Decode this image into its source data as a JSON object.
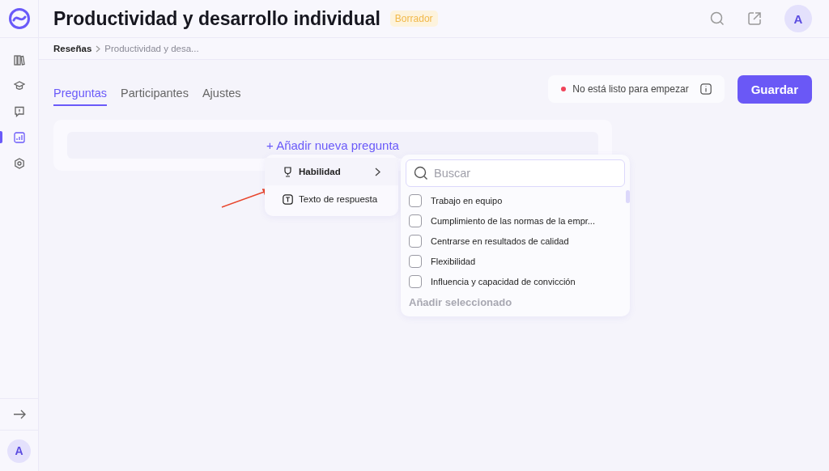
{
  "sidebar": {
    "items": [
      {
        "kind": "library",
        "selected": false
      },
      {
        "kind": "learning",
        "selected": false
      },
      {
        "kind": "feedback",
        "selected": false
      },
      {
        "kind": "reviews",
        "selected": true
      },
      {
        "kind": "settings",
        "selected": false
      }
    ],
    "user_avatar": "A"
  },
  "header": {
    "title": "Productividad y desarrollo individual",
    "badge": "Borrador",
    "user_avatar": "A"
  },
  "breadcrumb": [
    "Reseñas",
    "Productividad y desa..."
  ],
  "tabs": [
    {
      "label": "Preguntas",
      "selected": true
    },
    {
      "label": "Participantes",
      "selected": false
    },
    {
      "label": "Ajustes",
      "selected": false
    }
  ],
  "status": {
    "text": "No está listo para empezar",
    "color": "#f0445a"
  },
  "save_button": "Guardar",
  "add_question": "+ Añadir nueva pregunta",
  "type_menu": [
    {
      "kind": "skill",
      "label": "Habilidad",
      "expanded": true
    },
    {
      "kind": "text",
      "label": "Texto de respuesta",
      "expanded": false
    }
  ],
  "skill_picker": {
    "placeholder": "Buscar",
    "items": [
      {
        "label": "Trabajo en equipo",
        "checked": false
      },
      {
        "label": "Cumplimiento de las normas de la empr...",
        "checked": false
      },
      {
        "label": "Centrarse en resultados de calidad",
        "checked": false
      },
      {
        "label": "Flexibilidad",
        "checked": false
      },
      {
        "label": "Influencia y capacidad de convicción",
        "checked": false
      }
    ],
    "add_button": "Añadir seleccionado"
  }
}
